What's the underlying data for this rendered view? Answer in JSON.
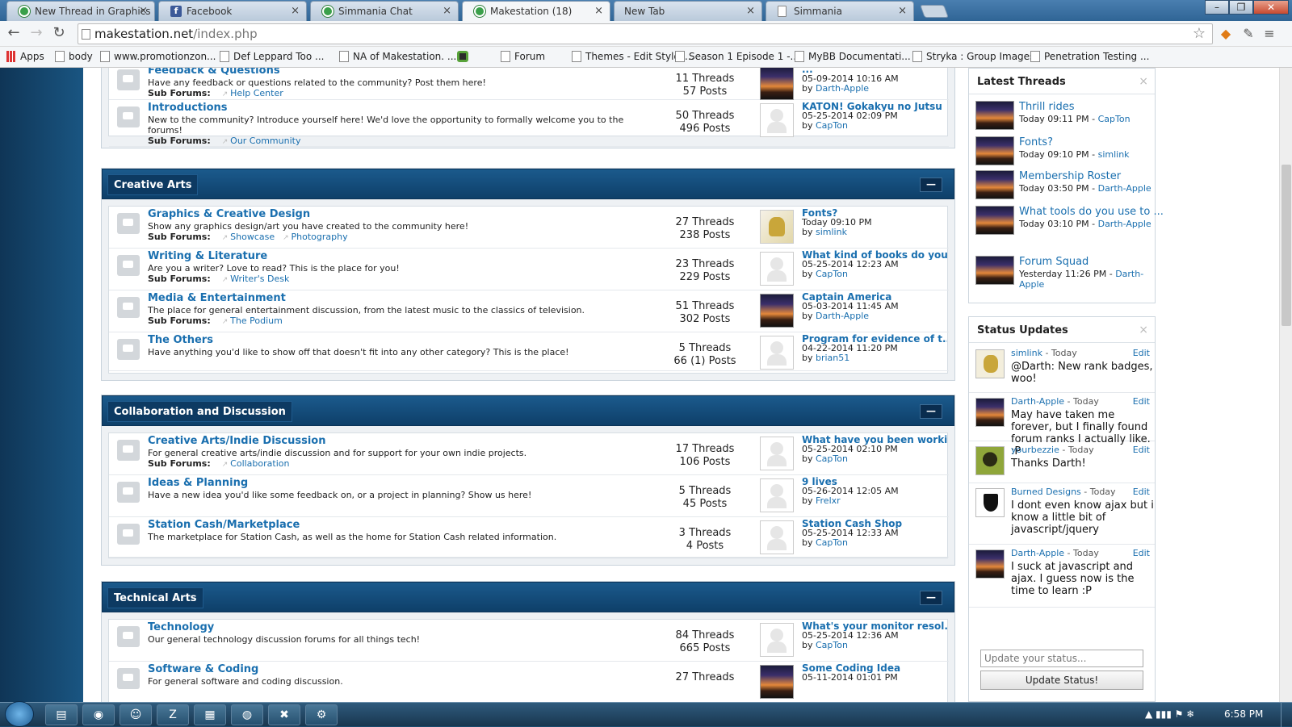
{
  "browser": {
    "tabs": [
      {
        "title": "New Thread in Graphics &",
        "icon": "chrome-favicon"
      },
      {
        "title": "Facebook",
        "icon": "facebook-favicon"
      },
      {
        "title": "Simmania Chat",
        "icon": "chrome-favicon"
      },
      {
        "title": "Makestation (18)",
        "icon": "chrome-favicon",
        "active": true
      },
      {
        "title": "New Tab",
        "icon": "none"
      },
      {
        "title": "Simmania",
        "icon": "page-favicon"
      }
    ],
    "url_host": "makestation.net",
    "url_path": "/index.php",
    "bookmarks": [
      "Apps",
      "body",
      "www.promotionzon...",
      "Def Leppard Too ...",
      "NA of Makestation. ...",
      "Forum",
      "Themes - Edit Styles...",
      "Season 1 Episode 1 -...",
      "MyBB Documentati...",
      "Stryka : Group Images",
      "Penetration Testing ..."
    ]
  },
  "categories": [
    {
      "name": "",
      "forums": [
        {
          "title": "Feedback & Questions",
          "desc": "Have any feedback or questions related to the community? Post them here!",
          "sub_label": "Sub Forums:",
          "subs": [
            "Help Center"
          ],
          "threads": "11 Threads",
          "posts": "57 Posts",
          "last_title": "...",
          "last_date": "05-09-2014 10:16 AM",
          "last_by_label": "by",
          "last_by": "Darth-Apple",
          "avatar": "sun"
        },
        {
          "title": "Introductions",
          "desc": "New to the community? Introduce yourself here! We'd love the opportunity to formally welcome you to the forums!",
          "sub_label": "Sub Forums:",
          "subs": [
            "Our Community"
          ],
          "threads": "50 Threads",
          "posts": "496 Posts",
          "last_title": "KATON! Gokakyu no Jutsu",
          "last_date": "05-25-2014 02:09 PM",
          "last_by_label": "by",
          "last_by": "CapTon",
          "avatar": "blank"
        }
      ]
    },
    {
      "name": "Creative Arts",
      "collapse_label": "—",
      "forums": [
        {
          "title": "Graphics & Creative Design",
          "desc": "Show any graphics design/art you have created to the community here!",
          "sub_label": "Sub Forums:",
          "subs": [
            "Showcase",
            "Photography"
          ],
          "threads": "27 Threads",
          "posts": "238 Posts",
          "last_title": "Fonts?",
          "last_date": "Today 09:10 PM",
          "last_by_label": "by",
          "last_by": "simlink",
          "avatar": "cat1"
        },
        {
          "title": "Writing & Literature",
          "desc": "Are you a writer? Love to read? This is the place for you!",
          "sub_label": "Sub Forums:",
          "subs": [
            "Writer's Desk"
          ],
          "threads": "23 Threads",
          "posts": "229 Posts",
          "last_title": "What kind of books do you...",
          "last_date": "05-25-2014 12:23 AM",
          "last_by_label": "by",
          "last_by": "CapTon",
          "avatar": "blank"
        },
        {
          "title": "Media & Entertainment",
          "desc": "The place for general entertainment discussion, from the latest music to the classics of television.",
          "sub_label": "Sub Forums:",
          "subs": [
            "The Podium"
          ],
          "threads": "51 Threads",
          "posts": "302 Posts",
          "last_title": "Captain America",
          "last_date": "05-03-2014 11:45 AM",
          "last_by_label": "by",
          "last_by": "Darth-Apple",
          "avatar": "sun"
        },
        {
          "title": "The Others",
          "desc": "Have anything you'd like to show off that doesn't fit into any other category? This is the place!",
          "sub_label": "",
          "subs": [],
          "threads": "5 Threads",
          "posts": "66 (1) Posts",
          "last_title": "Program for evidence of t...",
          "last_date": "04-22-2014 11:20 PM",
          "last_by_label": "by",
          "last_by": "brian51",
          "avatar": "blank"
        }
      ]
    },
    {
      "name": "Collaboration and Discussion",
      "collapse_label": "—",
      "forums": [
        {
          "title": "Creative Arts/Indie Discussion",
          "desc": "For general creative arts/indie discussion and for support for your own indie projects.",
          "sub_label": "Sub Forums:",
          "subs": [
            "Collaboration"
          ],
          "threads": "17 Threads",
          "posts": "106 Posts",
          "last_title": "What have you been workin...",
          "last_date": "05-25-2014 02:10 PM",
          "last_by_label": "by",
          "last_by": "CapTon",
          "avatar": "blank"
        },
        {
          "title": "Ideas & Planning",
          "desc": "Have a new idea you'd like some feedback on, or a project in planning? Show us here!",
          "sub_label": "",
          "subs": [],
          "threads": "5 Threads",
          "posts": "45 Posts",
          "last_title": "9 lives",
          "last_date": "05-26-2014 12:05 AM",
          "last_by_label": "by",
          "last_by": "Frelxr",
          "avatar": "blank"
        },
        {
          "title": "Station Cash/Marketplace",
          "desc": "The marketplace for Station Cash, as well as the home for Station Cash related information.",
          "sub_label": "",
          "subs": [],
          "threads": "3 Threads",
          "posts": "4 Posts",
          "last_title": "Station Cash Shop",
          "last_date": "05-25-2014 12:33 AM",
          "last_by_label": "by",
          "last_by": "CapTon",
          "avatar": "blank"
        }
      ]
    },
    {
      "name": "Technical Arts",
      "collapse_label": "—",
      "forums": [
        {
          "title": "Technology",
          "desc": "Our general technology discussion forums for all things tech!",
          "sub_label": "",
          "subs": [],
          "threads": "84 Threads",
          "posts": "665 Posts",
          "last_title": "What's your monitor resol...",
          "last_date": "05-25-2014 12:36 AM",
          "last_by_label": "by",
          "last_by": "CapTon",
          "avatar": "blank"
        },
        {
          "title": "Software & Coding",
          "desc": "For general software and coding discussion.",
          "sub_label": "",
          "subs": [],
          "threads": "27 Threads",
          "posts": "",
          "last_title": "Some Coding Idea",
          "last_date": "05-11-2014 01:01 PM",
          "last_by_label": "",
          "last_by": "",
          "avatar": "sun"
        }
      ]
    }
  ],
  "latest_threads": {
    "title": "Latest Threads",
    "close": "×",
    "items": [
      {
        "title": "Thrill rides",
        "time": "Today 09:11 PM - ",
        "by": "CapTon"
      },
      {
        "title": "Fonts?",
        "time": "Today 09:10 PM - ",
        "by": "simlink"
      },
      {
        "title": "Membership Roster",
        "time": "Today 03:50 PM - ",
        "by": "Darth-Apple"
      },
      {
        "title": "What tools do you use to ...",
        "time": "Today 03:10 PM - ",
        "by": "Darth-Apple"
      },
      {
        "title": "Forum Squad",
        "time": "Yesterday 11:26 PM - ",
        "by": "Darth-Apple"
      }
    ]
  },
  "status_updates": {
    "title": "Status Updates",
    "close": "×",
    "edit_label": "Edit",
    "items": [
      {
        "user": "simlink",
        "when": " - Today",
        "msg": "@Darth: New rank badges, woo!",
        "avatar": "cat1"
      },
      {
        "user": "Darth-Apple",
        "when": " - Today",
        "msg": "May have taken me forever, but I finally found forum ranks I actually like. :P",
        "avatar": "sun"
      },
      {
        "user": "yourbezzie",
        "when": " - Today",
        "msg": "Thanks Darth!",
        "avatar": "face"
      },
      {
        "user": "Burned Designs",
        "when": " - Today",
        "msg": "I dont even know ajax but i know a little bit of javascript/jquery",
        "avatar": "shield"
      },
      {
        "user": "Darth-Apple",
        "when": " - Today",
        "msg": "I suck at javascript and ajax. I guess now is the time to learn :P",
        "avatar": "sun"
      }
    ],
    "input_placeholder": "Update your status...",
    "button": "Update Status!"
  },
  "taskbar": {
    "apps": [
      "folder-icon",
      "chrome-icon",
      "gimp-icon",
      "filezilla-icon",
      "notepad-icon",
      "firefox-icon",
      "xampp-icon",
      "dev-icon"
    ],
    "clock": "6:58 PM"
  },
  "colors": {
    "link": "#1a6faf",
    "header": "#0e3f69",
    "background": "#1c5d8c"
  }
}
